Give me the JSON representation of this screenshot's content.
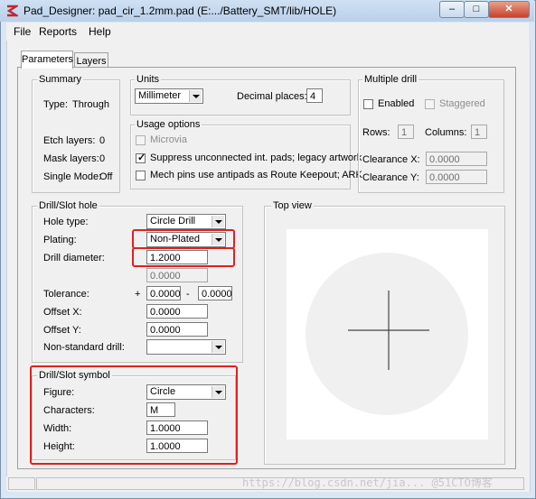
{
  "window": {
    "title": "Pad_Designer: pad_cir_1.2mm.pad (E:.../Battery_SMT/lib/HOLE)",
    "minimize_glyph": "–",
    "maximize_glyph": "□",
    "close_glyph": "✕"
  },
  "menu": [
    "File",
    "Reports",
    "Help"
  ],
  "tabs": [
    "Parameters",
    "Layers"
  ],
  "summary": {
    "title": "Summary",
    "type_label": "Type:",
    "type_value": "Through",
    "etch_label": "Etch layers:",
    "etch_value": "0",
    "mask_label": "Mask layers:",
    "mask_value": "0",
    "single_label": "Single Mode:",
    "single_value": "Off"
  },
  "units": {
    "title": "Units",
    "unit_value": "Millimeter",
    "decimal_label": "Decimal places:",
    "decimal_value": "4"
  },
  "usage": {
    "title": "Usage options",
    "microvia": "Microvia",
    "suppress": "Suppress unconnected int. pads; legacy artwork",
    "mech": "Mech pins use antipads as Route Keepout; ARK"
  },
  "multiple_drill": {
    "title": "Multiple drill",
    "enabled": "Enabled",
    "staggered": "Staggered",
    "rows_label": "Rows:",
    "rows_value": "1",
    "cols_label": "Columns:",
    "cols_value": "1",
    "clrx_label": "Clearance X:",
    "clrx_value": "0.0000",
    "clry_label": "Clearance Y:",
    "clry_value": "0.0000"
  },
  "drill_hole": {
    "title": "Drill/Slot hole",
    "hole_type_label": "Hole type:",
    "hole_type_value": "Circle Drill",
    "plating_label": "Plating:",
    "plating_value": "Non-Plated",
    "diameter_label": "Drill diameter:",
    "diameter_value": "1.2000",
    "secondary_value": "0.0000",
    "tolerance_label": "Tolerance:",
    "tol_plus": "+",
    "tol_plus_value": "0.0000",
    "tol_minus": "-",
    "tol_minus_value": "0.0000",
    "offx_label": "Offset X:",
    "offx_value": "0.0000",
    "offy_label": "Offset Y:",
    "offy_value": "0.0000",
    "nonstd_label": "Non-standard drill:",
    "nonstd_value": ""
  },
  "drill_symbol": {
    "title": "Drill/Slot symbol",
    "figure_label": "Figure:",
    "figure_value": "Circle",
    "chars_label": "Characters:",
    "chars_value": "M",
    "width_label": "Width:",
    "width_value": "1.0000",
    "height_label": "Height:",
    "height_value": "1.0000"
  },
  "top_view": {
    "title": "Top view"
  },
  "watermark": "https://blog.csdn.net/jia...  @51CTO博客",
  "colors": {
    "highlight": "#e02020",
    "titlebar": "#c4d8ee"
  }
}
